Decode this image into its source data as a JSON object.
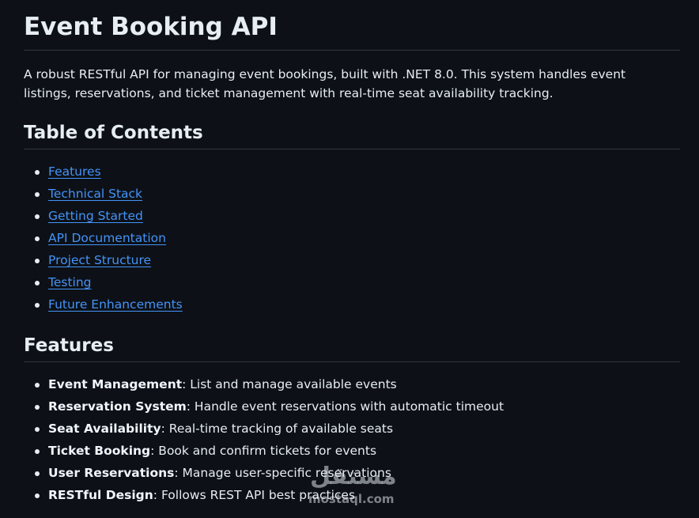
{
  "readme": {
    "title": "Event Booking API",
    "intro": "A robust RESTful API for managing event bookings, built with .NET 8.0. This system handles event listings, reservations, and ticket management with real-time seat availability tracking.",
    "toc": {
      "heading": "Table of Contents",
      "items": [
        {
          "label": "Features"
        },
        {
          "label": "Technical Stack"
        },
        {
          "label": "Getting Started"
        },
        {
          "label": "API Documentation"
        },
        {
          "label": "Project Structure"
        },
        {
          "label": "Testing"
        },
        {
          "label": "Future Enhancements"
        }
      ]
    },
    "features": {
      "heading": "Features",
      "items": [
        {
          "name": "Event Management",
          "desc": ": List and manage available events"
        },
        {
          "name": "Reservation System",
          "desc": ": Handle event reservations with automatic timeout"
        },
        {
          "name": "Seat Availability",
          "desc": ": Real-time tracking of available seats"
        },
        {
          "name": "Ticket Booking",
          "desc": ": Book and confirm tickets for events"
        },
        {
          "name": "User Reservations",
          "desc": ": Manage user-specific reservations"
        },
        {
          "name": "RESTful Design",
          "desc": ": Follows REST API best practices"
        }
      ]
    }
  },
  "watermark": {
    "arabic": "مستقل",
    "latin": "mostaql.com"
  },
  "colors": {
    "background": "#0d1117",
    "text": "#e6edf3",
    "link": "#4493f8",
    "divider": "#30363d"
  }
}
